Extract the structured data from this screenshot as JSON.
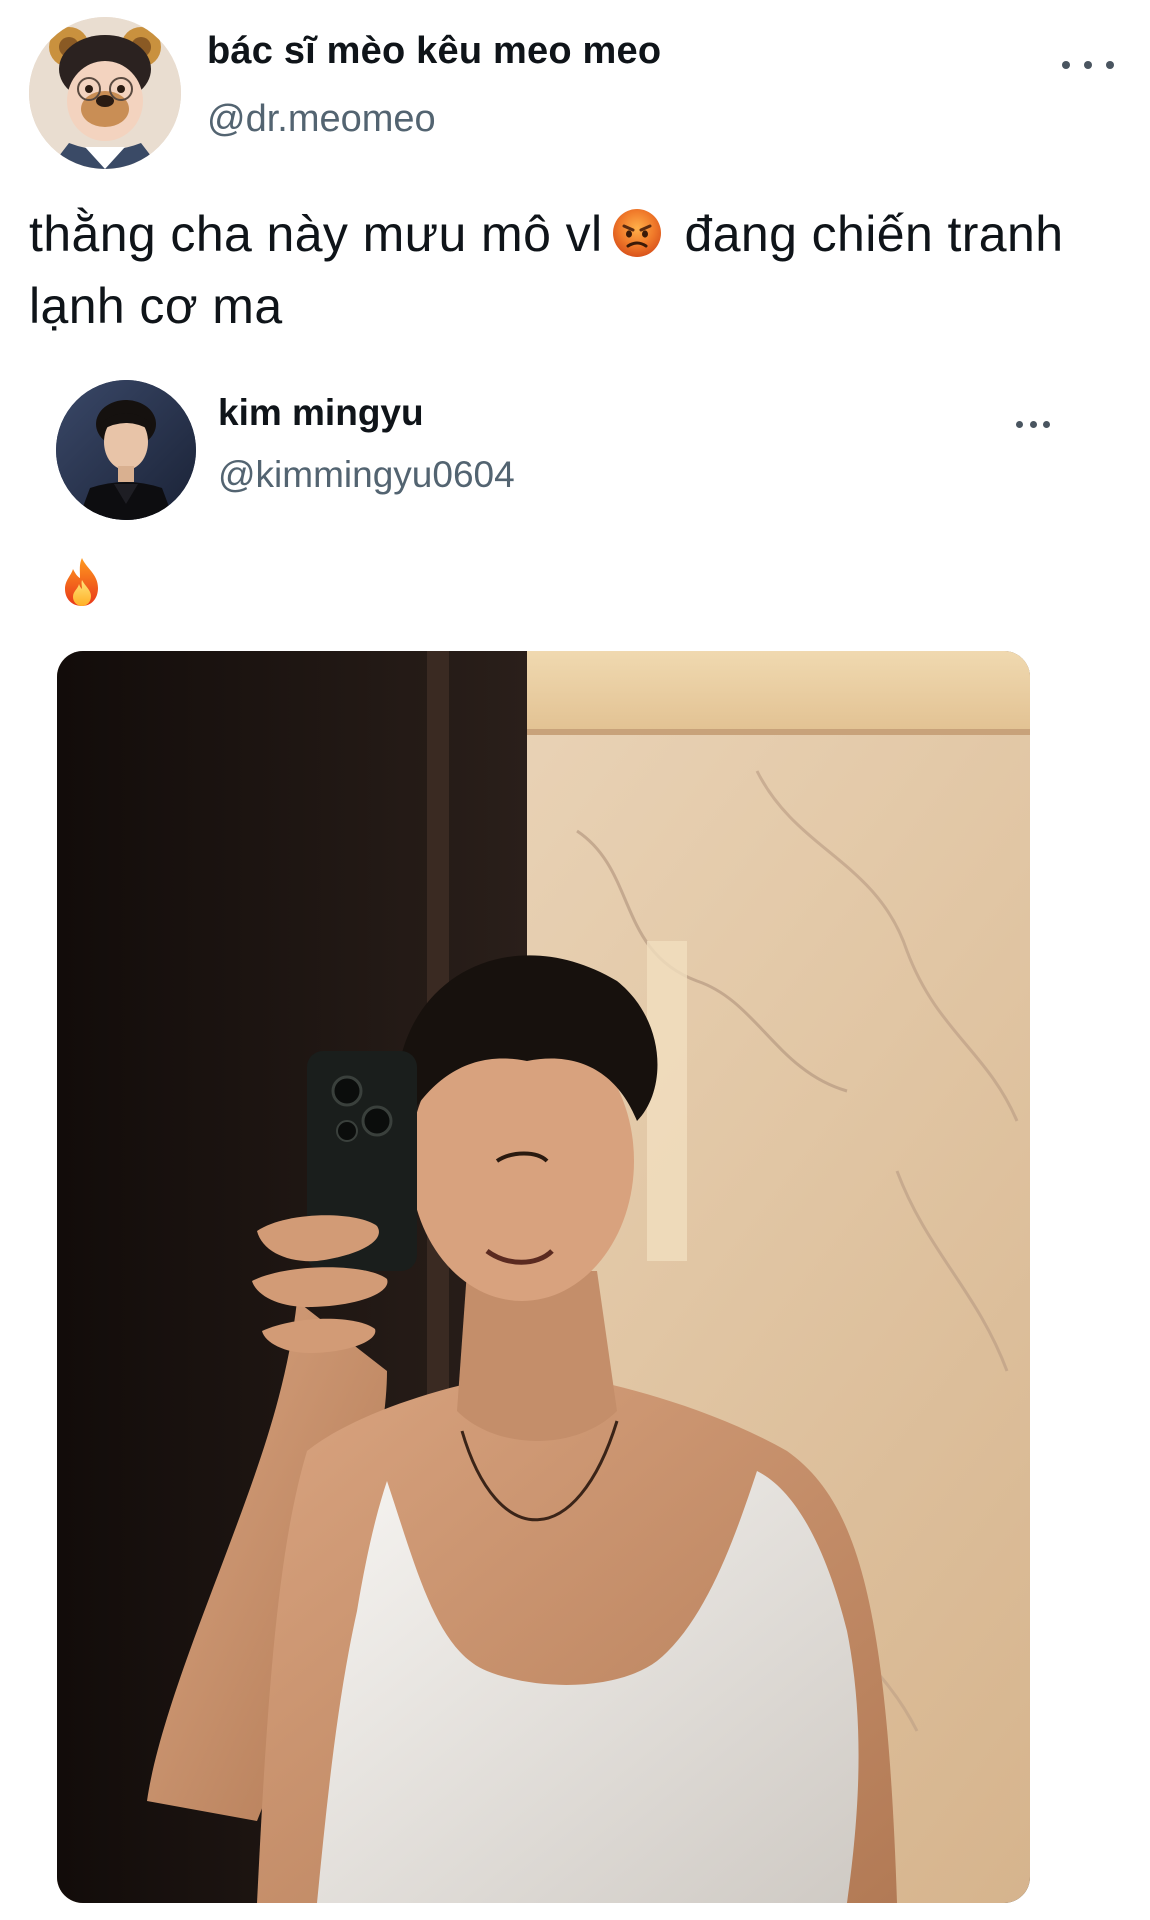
{
  "post": {
    "author_name": "bác sĩ mèo kêu meo meo",
    "author_handle": "@dr.meomeo",
    "text_before_emoji": "thằng cha này mưu mô vl",
    "emoji": "angry-face-icon",
    "text_after_emoji": "đang chiến tranh lạnh cơ ma",
    "more_icon": "more-dots-icon"
  },
  "quoted_post": {
    "author_name": "kim mingyu",
    "author_handle": "@kimmingyu0604",
    "emoji": "fire-icon",
    "more_icon": "more-dots-icon",
    "media": {
      "type": "photo"
    }
  },
  "colors": {
    "text_primary": "#0f1419",
    "text_secondary": "#536471",
    "background": "#ffffff"
  }
}
